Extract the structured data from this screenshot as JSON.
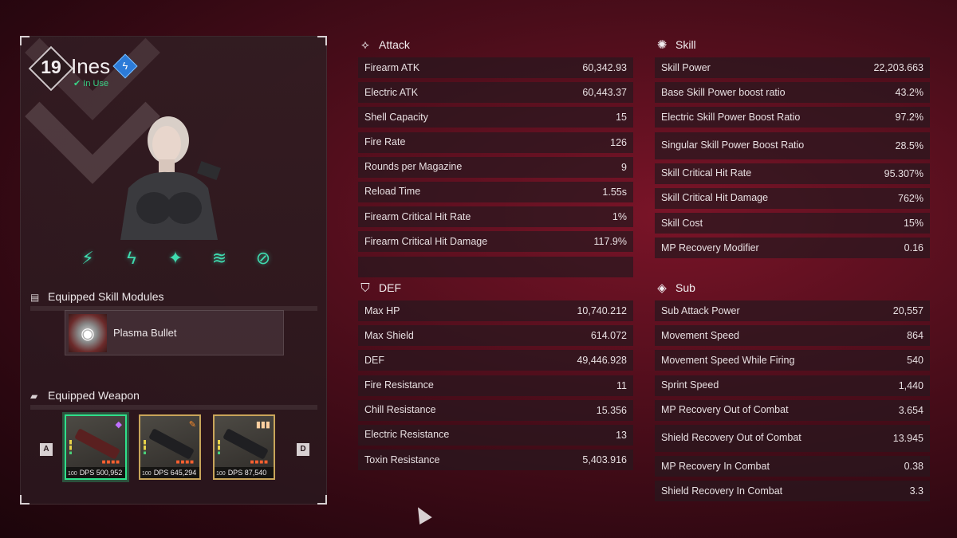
{
  "character": {
    "level": "19",
    "name": "Ines",
    "element_icon": "electric-bolt-icon",
    "status": "In Use",
    "skills": [
      "skill-1-icon",
      "skill-2-icon",
      "skill-3-icon",
      "skill-4-icon",
      "skill-5-icon"
    ]
  },
  "modules": {
    "title": "Equipped Skill Modules",
    "items": [
      {
        "name": "Plasma Bullet"
      }
    ]
  },
  "weapons": {
    "title": "Equipped Weapon",
    "key_prev": "A",
    "key_next": "D",
    "items": [
      {
        "lv": "100",
        "dps_label": "DPS",
        "dps": "500,952",
        "selected": true
      },
      {
        "lv": "100",
        "dps_label": "DPS",
        "dps": "645,294",
        "selected": false
      },
      {
        "lv": "100",
        "dps_label": "DPS",
        "dps": "87,540",
        "selected": false
      }
    ]
  },
  "attack": {
    "title": "Attack",
    "rows": [
      {
        "label": "Firearm ATK",
        "value": "60,342.93"
      },
      {
        "label": "Electric ATK",
        "value": "60,443.37"
      },
      {
        "label": "Shell Capacity",
        "value": "15"
      },
      {
        "label": "Fire Rate",
        "value": "126"
      },
      {
        "label": "Rounds per Magazine",
        "value": "9"
      },
      {
        "label": "Reload Time",
        "value": "1.55s"
      },
      {
        "label": "Firearm Critical Hit Rate",
        "value": "1%"
      },
      {
        "label": "Firearm Critical Hit Damage",
        "value": "117.9%"
      },
      {
        "label": "",
        "value": ""
      }
    ]
  },
  "skill": {
    "title": "Skill",
    "rows": [
      {
        "label": "Skill Power",
        "value": "22,203.663"
      },
      {
        "label": "Base Skill Power boost ratio",
        "value": "43.2%"
      },
      {
        "label": "Electric Skill Power Boost Ratio",
        "value": "97.2%"
      },
      {
        "label": "Singular Skill Power Boost Ratio",
        "value": "28.5%",
        "tall": true
      },
      {
        "label": "Skill Critical Hit Rate",
        "value": "95.307%"
      },
      {
        "label": "Skill Critical Hit Damage",
        "value": "762%"
      },
      {
        "label": "Skill Cost",
        "value": "15%"
      },
      {
        "label": "MP Recovery Modifier",
        "value": "0.16"
      }
    ]
  },
  "def": {
    "title": "DEF",
    "rows": [
      {
        "label": "Max HP",
        "value": "10,740.212"
      },
      {
        "label": "Max Shield",
        "value": "614.072"
      },
      {
        "label": "DEF",
        "value": "49,446.928"
      },
      {
        "label": "Fire Resistance",
        "value": "11"
      },
      {
        "label": "Chill Resistance",
        "value": "15.356"
      },
      {
        "label": "Electric Resistance",
        "value": "13"
      },
      {
        "label": "Toxin Resistance",
        "value": "5,403.916"
      }
    ]
  },
  "sub": {
    "title": "Sub",
    "rows": [
      {
        "label": "Sub Attack Power",
        "value": "20,557"
      },
      {
        "label": "Movement Speed",
        "value": "864"
      },
      {
        "label": "Movement Speed While Firing",
        "value": "540"
      },
      {
        "label": "Sprint Speed",
        "value": "1,440"
      },
      {
        "label": "MP Recovery Out of Combat",
        "value": "3.654"
      },
      {
        "label": "Shield Recovery Out of Combat",
        "value": "13.945",
        "tall": true
      },
      {
        "label": "MP Recovery In Combat",
        "value": "0.38"
      },
      {
        "label": "Shield Recovery In Combat",
        "value": "3.3"
      }
    ]
  }
}
